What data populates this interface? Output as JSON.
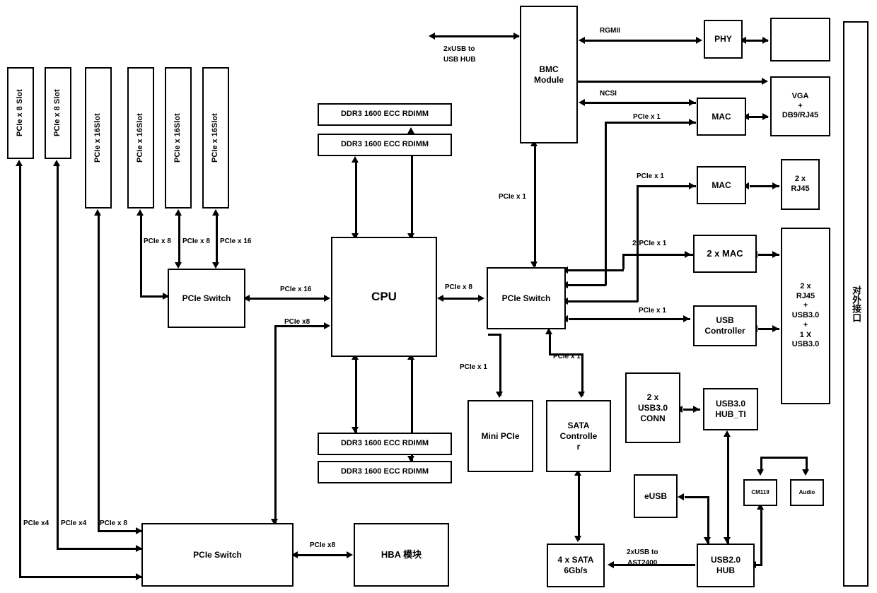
{
  "diagram": {
    "title": "Server Mainboard Block Diagram",
    "line_color": "#000000",
    "box_fill": "#ffffff"
  },
  "slots": [
    {
      "label": "PCIe x 8 Slot"
    },
    {
      "label": "PCIe x 8 Slot"
    },
    {
      "label": "PCIe x 16Slot"
    },
    {
      "label": "PCIe x 16Slot"
    },
    {
      "label": "PCIe x 16Slot"
    },
    {
      "label": "PCIe x 16Slot"
    }
  ],
  "blocks": {
    "cpu": "CPU",
    "pcie_switch_left": "PCIe Switch",
    "pcie_switch_right": "PCIe Switch",
    "pcie_switch_bottom": "PCIe Switch",
    "hba": "HBA 模块",
    "ddr3_top_1": "DDR3 1600 ECC RDIMM",
    "ddr3_top_2": "DDR3 1600 ECC RDIMM",
    "ddr3_bot_1": "DDR3 1600 ECC RDIMM",
    "ddr3_bot_2": "DDR3 1600 ECC RDIMM",
    "bmc": "BMC\nModule",
    "phy": "PHY",
    "phy_peer": "",
    "vga": "VGA\n+\nDB9/RJ45",
    "mac_1": "MAC",
    "mac_2": "MAC",
    "rj45_2x": "2 x\nRJ45",
    "mac_2x": "2 x MAC",
    "usb_controller": "USB\nController",
    "external_ports_col": "2 x\nRJ45\n+\nUSB3.0\n+\n1 X\nUSB3.0",
    "external_interface": "对外接口",
    "mini_pcie": "Mini PCIe",
    "sata_controller": "SATA\nControlle\nr",
    "usb3_conn": "2 x\nUSB3.0\nCONN",
    "usb3_hub": "USB3.0\nHUB_TI",
    "eusb": "eUSB",
    "cm119": "CM119",
    "audio": "Audio",
    "usb2_hub": "USB2.0\nHUB",
    "sata_4x": "4 x SATA\n6Gb/s"
  },
  "edge_labels": {
    "slot_pcie_x8_a": "PCIe x 8",
    "slot_pcie_x8_b": "PCIe x 8",
    "slot_pcie_x16": "PCIe x 16",
    "sw_to_cpu_x16": "PCIe x 16",
    "sw_to_cpu_x8": "PCIe x8",
    "cpu_to_sw_x8": "PCIe x 8",
    "bmc_usb": "2xUSB    to\nUSB HUB",
    "rgmii": "RGMII",
    "ncsi": "NCSI",
    "pcie_x1_mac1": "PCIe x 1",
    "pcie_x1_mac2": "PCIe x 1",
    "pcie_x1_bmc": "PCIe x 1",
    "pcie_2x1_mac2x": "2*PCIe x 1",
    "pcie_x1_usbctrl": "PCIe x 1",
    "pcie_x1_minipcie": "PCIe x 1",
    "pcie_x1_sata": "PCIe x 1",
    "bottom_x4_a": "PCIe x4",
    "bottom_x4_b": "PCIe x4",
    "bottom_x8": "PCIe x 8",
    "hba_x8": "PCIe x8",
    "usb_ast2400": "2xUSB to\nAST2400"
  }
}
